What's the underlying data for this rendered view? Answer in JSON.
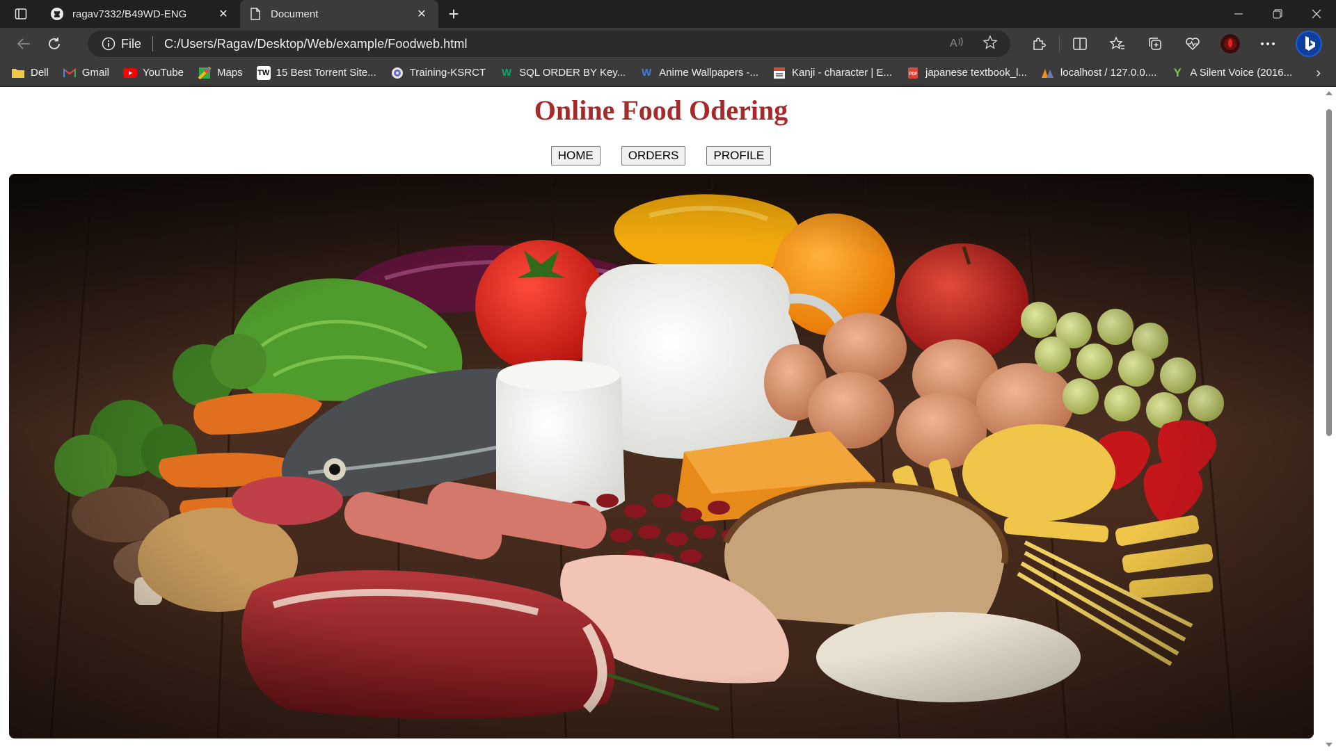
{
  "browser": {
    "tabs": [
      {
        "title": "ragav7332/B49WD-ENG",
        "icon": "github-icon",
        "active": false
      },
      {
        "title": "Document",
        "icon": "document-icon",
        "active": true
      }
    ],
    "address": {
      "scheme_label": "File",
      "url": "C:/Users/Ragav/Desktop/Web/example/Foodweb.html"
    },
    "bookmarks": [
      {
        "label": "Dell",
        "icon": "folder-icon",
        "color": "#f2c744"
      },
      {
        "label": "Gmail",
        "icon": "gmail-icon",
        "color": "#ea4335"
      },
      {
        "label": "YouTube",
        "icon": "youtube-icon",
        "color": "#ff0000"
      },
      {
        "label": "Maps",
        "icon": "maps-icon",
        "color": "#34a853"
      },
      {
        "label": "15 Best Torrent Site...",
        "icon": "tw-icon",
        "color": "#ffffff"
      },
      {
        "label": "Training-KSRCT",
        "icon": "ksrct-icon",
        "color": "#6b6bd6"
      },
      {
        "label": "SQL ORDER BY Key...",
        "icon": "w3-icon",
        "color": "#04aa6d"
      },
      {
        "label": "Anime Wallpapers -...",
        "icon": "w-icon",
        "color": "#3f7fdc"
      },
      {
        "label": "Kanji - character | E...",
        "icon": "kanji-icon",
        "color": "#d6463c"
      },
      {
        "label": "japanese textbook_l...",
        "icon": "pdf-icon",
        "color": "#d6463c"
      },
      {
        "label": "localhost / 127.0.0....",
        "icon": "phpmyadmin-icon",
        "color": "#f29111"
      },
      {
        "label": "A Silent Voice (2016...",
        "icon": "y-icon",
        "color": "#7ac943"
      }
    ]
  },
  "page": {
    "title": "Online Food Odering",
    "title_color": "#a52a2a",
    "nav": {
      "home": "HOME",
      "orders": "ORDERS",
      "profile": "PROFILE"
    }
  }
}
